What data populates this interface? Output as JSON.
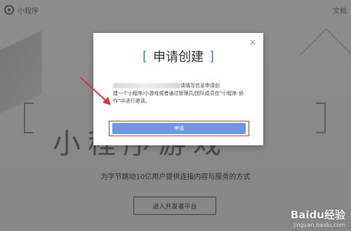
{
  "topbar": {
    "logo_text": "小程序",
    "right_link": "文档"
  },
  "hero": {
    "title": "小程序游戏",
    "subtitle": "为字节跳动10亿用户提供连接内容与服务的方式",
    "cta_label": "进入开发者平台"
  },
  "modal": {
    "title": "申请创建",
    "close_label": "×",
    "text_line1": "请填写信息申请创",
    "text_line2": "建一个小程序/小游戏或者通过管理员/团队成员在“小程序-协",
    "text_line3": "作”中进行邀请。",
    "confirm_label": "申请"
  },
  "watermark": {
    "main": "Baidu经验",
    "url": "jingyan.baidu.com"
  },
  "colors": {
    "accent": "#3f7ad9",
    "button": "#6d98e4",
    "highlight": "#d43a35"
  }
}
